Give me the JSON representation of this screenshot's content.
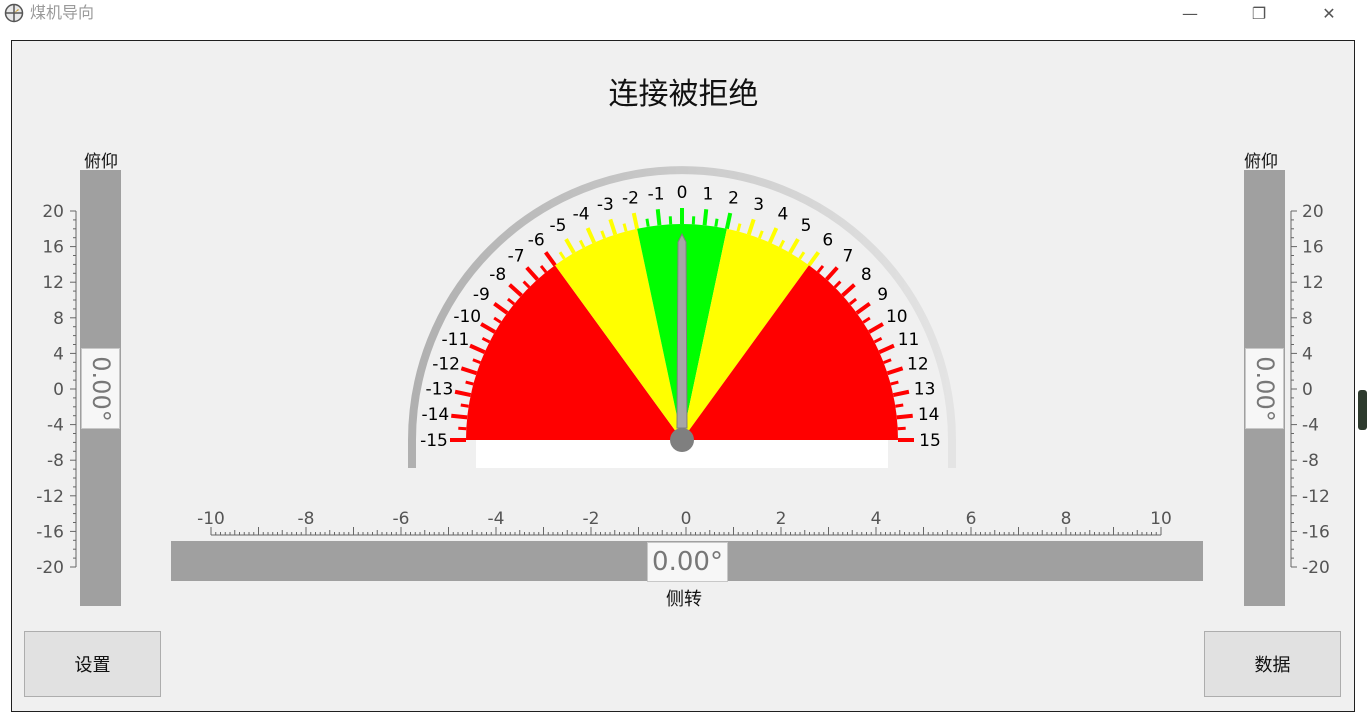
{
  "window": {
    "title": "煤机导向",
    "minimize_symbol": "—",
    "restore_symbol": "❐",
    "close_symbol": "✕"
  },
  "status_title": "连接被拒绝",
  "pitch_left": {
    "label": "俯仰",
    "value_text": "0.00°",
    "value": 0,
    "range": [
      -20,
      20
    ],
    "tick_labels": [
      "20",
      "16",
      "12",
      "8",
      "4",
      "0",
      "-4",
      "-8",
      "-12",
      "-16",
      "-20"
    ]
  },
  "pitch_right": {
    "label": "俯仰",
    "value_text": "0.00°",
    "value": 0,
    "range": [
      -20,
      20
    ],
    "tick_labels": [
      "20",
      "16",
      "12",
      "8",
      "4",
      "0",
      "-4",
      "-8",
      "-12",
      "-16",
      "-20"
    ]
  },
  "roll": {
    "label": "侧转",
    "value_text": "0.00°",
    "value": 0,
    "range": [
      -10,
      10
    ],
    "tick_labels": [
      "-10",
      "-8",
      "-6",
      "-4",
      "-2",
      "0",
      "2",
      "4",
      "6",
      "8",
      "10"
    ]
  },
  "gauge": {
    "value": 0,
    "min": -15,
    "max": 15,
    "tick_labels": [
      "-15",
      "-14",
      "-13",
      "-12",
      "-11",
      "-10",
      "-9",
      "-8",
      "-7",
      "-6",
      "-5",
      "-4",
      "-3",
      "-2",
      "-1",
      "0",
      "1",
      "2",
      "3",
      "4",
      "5",
      "6",
      "7",
      "8",
      "9",
      "10",
      "11",
      "12",
      "13",
      "14",
      "15"
    ],
    "zones": [
      {
        "from": -15,
        "to": -6,
        "color": "#ff0000"
      },
      {
        "from": -6,
        "to": -2,
        "color": "#ffff00"
      },
      {
        "from": -2,
        "to": 2,
        "color": "#00ff00"
      },
      {
        "from": 2,
        "to": 6,
        "color": "#ffff00"
      },
      {
        "from": 6,
        "to": 15,
        "color": "#ff0000"
      }
    ]
  },
  "buttons": {
    "settings": "设置",
    "data": "数据"
  },
  "colors": {
    "bar_fill": "#a0a0a0",
    "panel_bg": "#f0f0f0",
    "needle": "#a6a6a6"
  },
  "icons": {
    "app": "compass-crosshair-icon"
  }
}
